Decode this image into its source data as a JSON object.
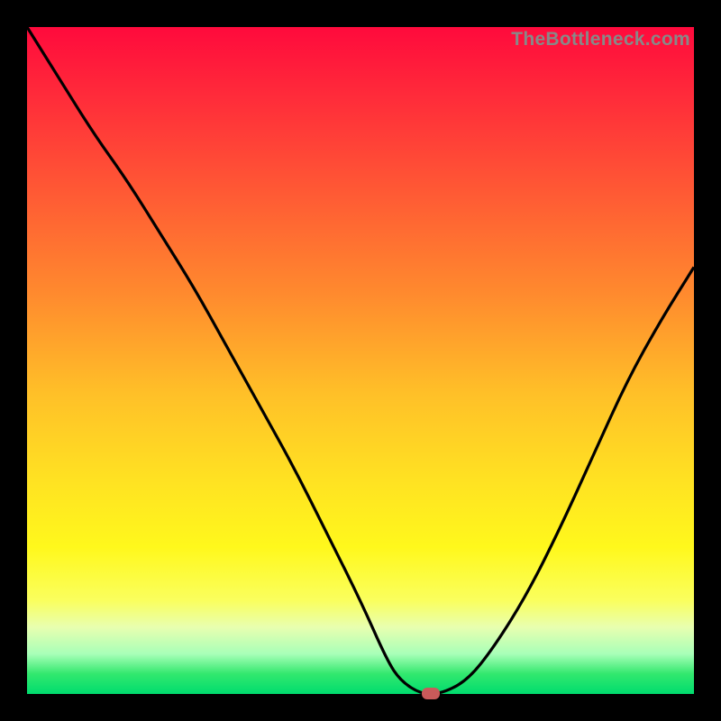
{
  "watermark": "TheBottleneck.com",
  "colors": {
    "frame": "#000000",
    "curve_stroke": "#000000",
    "marker_fill": "#c95a5a",
    "gradient_top": "#ff0a3c",
    "gradient_bottom": "#00dc6e"
  },
  "chart_data": {
    "type": "line",
    "title": "",
    "xlabel": "",
    "ylabel": "",
    "xlim": [
      0,
      100
    ],
    "ylim": [
      0,
      100
    ],
    "series": [
      {
        "name": "bottleneck-curve",
        "x": [
          0,
          5,
          10,
          15,
          20,
          25,
          30,
          35,
          40,
          45,
          50,
          54,
          56,
          59,
          62,
          66,
          70,
          75,
          80,
          85,
          90,
          95,
          100
        ],
        "values": [
          100,
          92,
          84,
          77,
          69,
          61,
          52,
          43,
          34,
          24,
          14,
          5,
          2,
          0,
          0,
          2,
          7,
          15,
          25,
          36,
          47,
          56,
          64
        ]
      }
    ],
    "marker": {
      "x": 60.5,
      "y": 0
    },
    "grid": false,
    "legend": false
  }
}
